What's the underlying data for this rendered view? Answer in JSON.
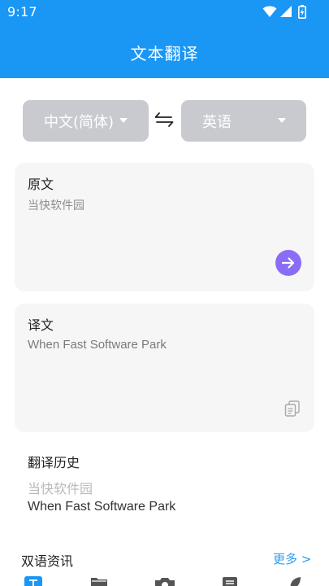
{
  "status_bar": {
    "time": "9:17",
    "icons": [
      "wifi-icon",
      "signal-icon",
      "battery-icon"
    ]
  },
  "app_bar": {
    "title": "文本翻译"
  },
  "language_selector": {
    "source_language": "中文(简体)",
    "target_language": "英语",
    "swap_icon": "swap-arrows-icon"
  },
  "source_card": {
    "title": "原文",
    "text": "当快软件园",
    "action_icon": "arrow-right-icon"
  },
  "result_card": {
    "title": "译文",
    "text": "When Fast Software Park",
    "action_icon": "copy-icon"
  },
  "history": {
    "title": "翻译历史",
    "items": [
      {
        "source": "当快软件园",
        "target": "When Fast Software Park"
      }
    ]
  },
  "news": {
    "title": "双语资讯",
    "more_label": "更多 >"
  },
  "bottom_nav": {
    "icons": [
      "text-translate-icon",
      "folder-icon",
      "camera-icon",
      "document-icon",
      "leaf-icon"
    ],
    "active_index": 0
  },
  "colors": {
    "primary": "#1a96f5",
    "accent_purple": "#8a6cf7",
    "link_blue": "#2a9df4",
    "language_button_bg": "#c8cacf",
    "card_bg": "#f6f6f7"
  }
}
